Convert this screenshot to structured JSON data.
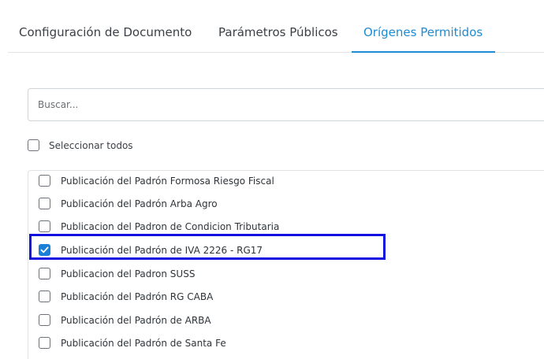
{
  "tabs": [
    {
      "label": "Configuración de Documento"
    },
    {
      "label": "Parámetros Públicos"
    },
    {
      "label": "Orígenes Permitidos",
      "active": true
    }
  ],
  "search": {
    "placeholder": "Buscar...",
    "value": ""
  },
  "select_all": {
    "label": "Seleccionar todos",
    "checked": false
  },
  "items": [
    {
      "label": "Publicación del Padrón Formosa Riesgo Fiscal",
      "checked": false
    },
    {
      "label": "Publicación del Padrón Arba Agro",
      "checked": false
    },
    {
      "label": "Publicacion del Padron de Condicion Tributaria",
      "checked": false
    },
    {
      "label": "Publicación del Padrón de IVA 2226 - RG17",
      "checked": true
    },
    {
      "label": "Publicacion del Padron SUSS",
      "checked": false
    },
    {
      "label": "Publicación del Padrón RG CABA",
      "checked": false
    },
    {
      "label": "Publicación del Padrón de ARBA",
      "checked": false
    },
    {
      "label": "Publicación del Padrón de Santa Fe",
      "checked": false
    }
  ],
  "colors": {
    "accent": "#1f8bd0",
    "checkbox_checked": "#1a7fd6",
    "highlight": "#1010e0"
  }
}
